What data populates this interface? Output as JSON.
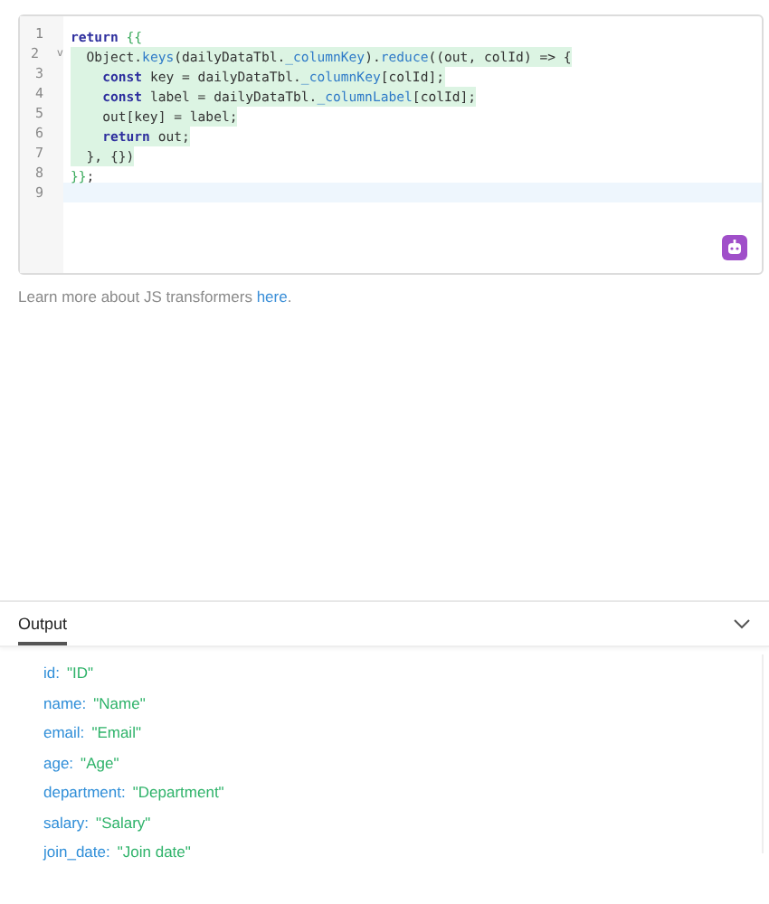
{
  "editor": {
    "lines": [
      {
        "number": "1",
        "highlighted": false,
        "active": false,
        "tokens": [
          {
            "text": "return ",
            "kind": "keyword"
          },
          {
            "text": "{{",
            "kind": "bracket"
          }
        ]
      },
      {
        "number": "2",
        "fold": "v",
        "highlighted": true,
        "active": false,
        "tokens": [
          {
            "text": "  Object.",
            "kind": "plain"
          },
          {
            "text": "keys",
            "kind": "method"
          },
          {
            "text": "(dailyDataTbl.",
            "kind": "plain"
          },
          {
            "text": "_columnKey",
            "kind": "method"
          },
          {
            "text": ").",
            "kind": "plain"
          },
          {
            "text": "reduce",
            "kind": "method"
          },
          {
            "text": "((out, colId) => {",
            "kind": "plain"
          }
        ]
      },
      {
        "number": "3",
        "highlighted": true,
        "active": false,
        "tokens": [
          {
            "text": "    const ",
            "kind": "keyword"
          },
          {
            "text": "key = dailyDataTbl.",
            "kind": "plain"
          },
          {
            "text": "_columnKey",
            "kind": "method"
          },
          {
            "text": "[colId];",
            "kind": "plain"
          }
        ]
      },
      {
        "number": "4",
        "highlighted": true,
        "active": false,
        "tokens": [
          {
            "text": "    const ",
            "kind": "keyword"
          },
          {
            "text": "label = dailyDataTbl.",
            "kind": "plain"
          },
          {
            "text": "_columnLabel",
            "kind": "method"
          },
          {
            "text": "[colId];",
            "kind": "plain"
          }
        ]
      },
      {
        "number": "5",
        "highlighted": true,
        "active": false,
        "tokens": [
          {
            "text": "    out[key] = label;",
            "kind": "plain"
          }
        ]
      },
      {
        "number": "6",
        "highlighted": true,
        "active": false,
        "tokens": [
          {
            "text": "    return ",
            "kind": "keyword"
          },
          {
            "text": "out;",
            "kind": "plain"
          }
        ]
      },
      {
        "number": "7",
        "highlighted": true,
        "active": false,
        "tokens": [
          {
            "text": "  }, {})",
            "kind": "plain"
          }
        ]
      },
      {
        "number": "8",
        "highlighted": false,
        "active": false,
        "tokens": [
          {
            "text": "}}",
            "kind": "bracket"
          },
          {
            "text": ";",
            "kind": "plain"
          }
        ]
      },
      {
        "number": "9",
        "highlighted": false,
        "active": true
      }
    ]
  },
  "help": {
    "text": "Learn more about JS transformers ",
    "link": "here",
    "end": "."
  },
  "output": {
    "tabs": [
      {
        "label": "Output",
        "selected": true
      }
    ],
    "entries": [
      {
        "key": "id:",
        "value": "\"ID\""
      },
      {
        "key": "name:",
        "value": "\"Name\""
      },
      {
        "key": "email:",
        "value": "\"Email\""
      },
      {
        "key": "age:",
        "value": "\"Age\""
      },
      {
        "key": "department:",
        "value": "\"Department\""
      },
      {
        "key": "salary:",
        "value": "\"Salary\""
      },
      {
        "key": "join_date:",
        "value": "\"Join date\""
      }
    ]
  }
}
